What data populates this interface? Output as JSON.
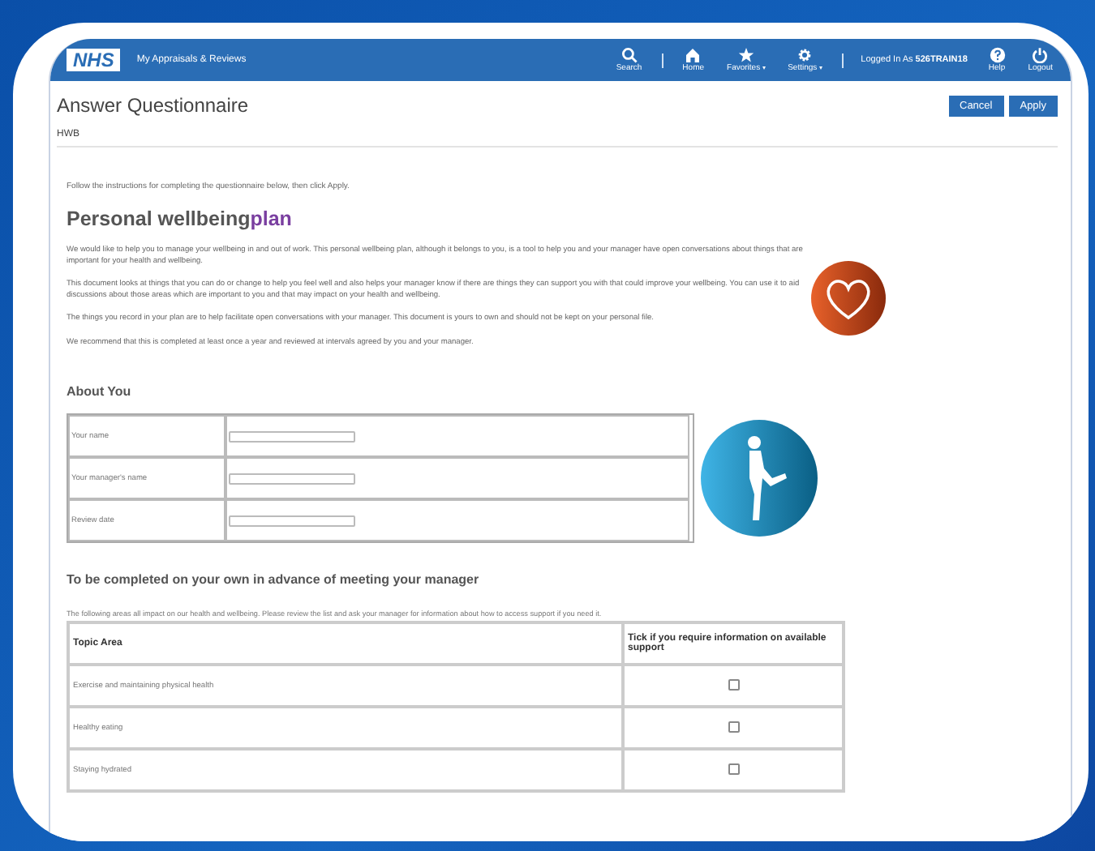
{
  "header": {
    "logo": "NHS",
    "app_title": "My Appraisals & Reviews",
    "nav": [
      {
        "kind": "search",
        "label": "Search",
        "menu": false
      },
      {
        "kind": "home",
        "label": "Home",
        "menu": false
      },
      {
        "kind": "star",
        "label": "Favorites",
        "menu": true
      },
      {
        "kind": "gear",
        "label": "Settings",
        "menu": true
      }
    ],
    "user_prefix": "Logged In As",
    "user": "526TRAIN18",
    "actions": [
      {
        "kind": "help",
        "label": "Help"
      },
      {
        "kind": "power",
        "label": "Logout"
      }
    ]
  },
  "page": {
    "title": "Answer Questionnaire",
    "buttons": [
      "Cancel",
      "Apply"
    ],
    "subtitle": "HWB",
    "instruction": "Follow the instructions for completing the questionnaire below, then click Apply."
  },
  "plan": {
    "heading": "Personal wellbeing",
    "heading_accent": "plan",
    "paragraphs": [
      "We would like to help you to manage your wellbeing in and out of work. This personal wellbeing plan, although it belongs to you, is a tool to help you and your manager have open conversations about things that are important for your health and wellbeing.",
      "This document looks at things that you can do or change to help you feel well and also helps your manager know if there are things they can support you with that could improve your wellbeing. You can use it to aid discussions about those areas which are important to you and that may impact on your health and wellbeing.",
      "The things you record in your plan are to help facilitate open conversations with your manager. This document is yours to own and should not be kept on your personal file.",
      "We recommend that this is completed at least once a year and reviewed at intervals agreed by you and your manager."
    ]
  },
  "about": {
    "heading": "About You",
    "fields": [
      {
        "label": "Your name"
      },
      {
        "label": "Your manager's name"
      },
      {
        "label": "Review date"
      }
    ]
  },
  "topics": {
    "heading": "To be completed on your own in advance of meeting your manager",
    "intro": "The following areas all impact on our health and wellbeing. Please review the list and ask your manager for information about how to access support if you need it.",
    "columns": [
      "Topic Area",
      "Tick if you require information on available support"
    ],
    "rows": [
      {
        "topic": "Exercise and maintaining physical health",
        "checked": false
      },
      {
        "topic": "Healthy eating",
        "checked": false
      },
      {
        "topic": "Staying hydrated",
        "checked": false
      }
    ]
  }
}
